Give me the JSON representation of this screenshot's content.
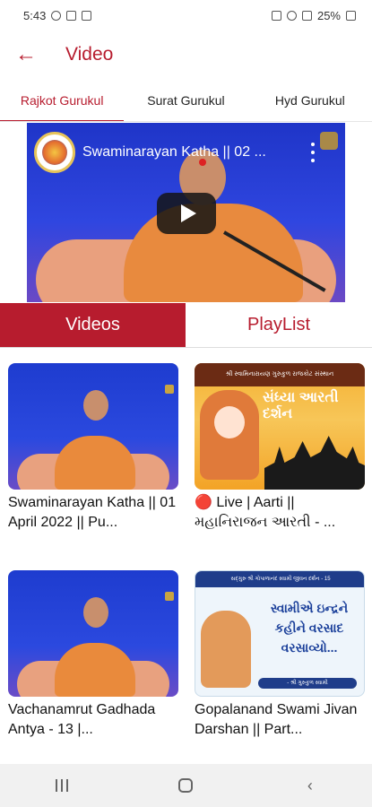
{
  "status_bar": {
    "time": "5:43",
    "battery": "25%"
  },
  "app_bar": {
    "title": "Video"
  },
  "tabs": [
    {
      "label": "Rajkot Gurukul",
      "active": true
    },
    {
      "label": "Surat Gurukul",
      "active": false
    },
    {
      "label": "Hyd Gurukul",
      "active": false
    }
  ],
  "player": {
    "title": "Swaminarayan Katha || 02 ..."
  },
  "segment": {
    "videos": "Videos",
    "playlist": "PlayList"
  },
  "videos": [
    {
      "title": "Swaminarayan Katha || 01 April 2022 || Pu..."
    },
    {
      "title": "🔴 Live | Aarti || મહાનિરાજન આરતી - ...",
      "banner": "શ્રી સ્વામિનારાયણ ગુરુકુળ રાજકોટ સંસ્થાન",
      "overlay": "સંધ્યા આરતી દર્શન"
    },
    {
      "title": "Vachanamrut Gadhada Antya - 13 |..."
    },
    {
      "title": "Gopalanand Swami Jivan Darshan || Part...",
      "banner": "સદ્ગુરુ શ્રી ગોપાળાનંદ સ્વામી જીવન દર્શન - 15",
      "overlay": "સ્વામીએ ઇન્દ્રને કહીને વરસાદ વરસાવ્યો...",
      "footer": "- શ્રી ગુરુકુળ સ્વામી"
    }
  ],
  "colors": {
    "accent": "#b71c2e"
  }
}
